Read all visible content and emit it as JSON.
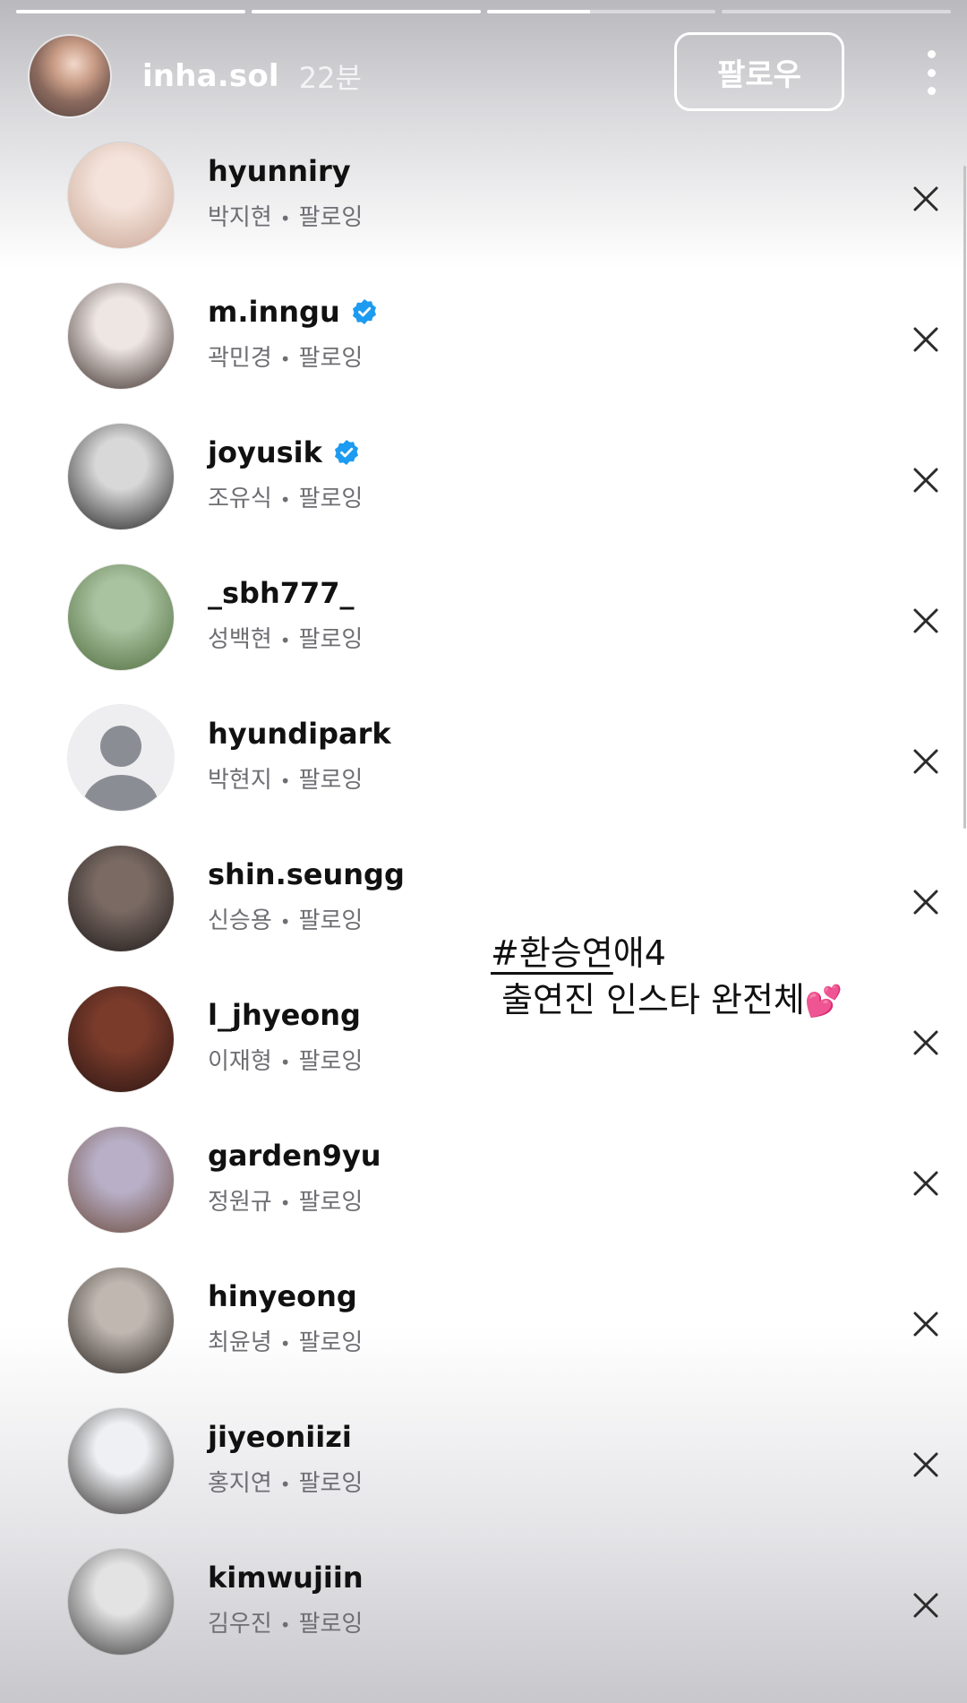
{
  "story": {
    "progress": [
      1.0,
      1.0,
      0.45,
      0.0
    ],
    "user": {
      "username": "inha.sol",
      "time": "22분"
    },
    "follow_label": "팔로우",
    "more_icon": "more-vertical-icon"
  },
  "list": {
    "items": [
      {
        "username": "hyunniry",
        "name": "박지현",
        "status": "팔로잉",
        "verified": false,
        "avatar_colors": [
          "#f4e3db",
          "#c9a594"
        ]
      },
      {
        "username": "m.inngu",
        "name": "곽민경",
        "status": "팔로잉",
        "verified": true,
        "avatar_colors": [
          "#ede6e3",
          "#3a2c28"
        ]
      },
      {
        "username": "joyusik",
        "name": "조유식",
        "status": "팔로잉",
        "verified": true,
        "avatar_colors": [
          "#d8d8d8",
          "#1e1e1e"
        ]
      },
      {
        "username": "_sbh777_",
        "name": "성백현",
        "status": "팔로잉",
        "verified": false,
        "avatar_colors": [
          "#a9c2a0",
          "#4e6b3b"
        ]
      },
      {
        "username": "hyundipark",
        "name": "박현지",
        "status": "팔로잉",
        "verified": false,
        "avatar_colors": [
          "#eeeef1",
          "#8a8d94"
        ]
      },
      {
        "username": "shin.seungg",
        "name": "신승용",
        "status": "팔로잉",
        "verified": false,
        "avatar_colors": [
          "#7a6a63",
          "#1c1818"
        ]
      },
      {
        "username": "l_jhyeong",
        "name": "이재형",
        "status": "팔로잉",
        "verified": false,
        "avatar_colors": [
          "#7a3b2b",
          "#2a1512"
        ]
      },
      {
        "username": "garden9yu",
        "name": "정원규",
        "status": "팔로잉",
        "verified": false,
        "avatar_colors": [
          "#b9b0c8",
          "#6b4a3c"
        ]
      },
      {
        "username": "hinyeong",
        "name": "최윤녕",
        "status": "팔로잉",
        "verified": false,
        "avatar_colors": [
          "#bfb7b0",
          "#2b2420"
        ]
      },
      {
        "username": "jiyeoniizi",
        "name": "홍지연",
        "status": "팔로잉",
        "verified": false,
        "avatar_colors": [
          "#eef0f3",
          "#2e2a28"
        ]
      },
      {
        "username": "kimwujiin",
        "name": "김우진",
        "status": "팔로잉",
        "verified": false,
        "avatar_colors": [
          "#e3e3e3",
          "#3a3a3a"
        ]
      }
    ],
    "separator": "•",
    "remove_icon": "close-icon",
    "verified_icon": "verified-badge-icon",
    "verified_color": "#1d9bf0"
  },
  "caption": {
    "tag": "#환승연",
    "tag_rest": "애4",
    "line2": "출연진 인스타 완전체",
    "emoji": "💕"
  }
}
